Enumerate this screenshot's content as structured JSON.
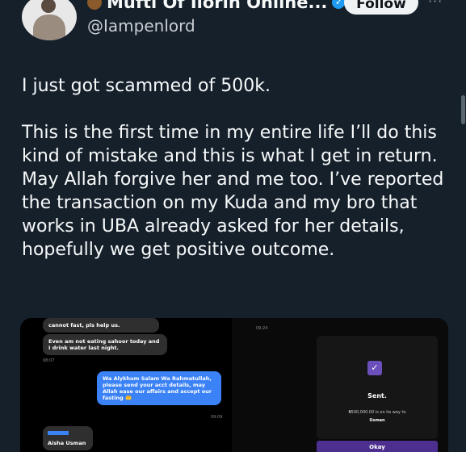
{
  "header": {
    "display_name": "Mufti Of Ilorin Online...",
    "handle": "@Iampenlord",
    "follow_label": "Follow",
    "more_label": "···"
  },
  "tweet": {
    "paragraphs": [
      "I just got scammed of 500k.",
      "This is the first time in my entire life I’ll do this kind of mistake and this is what I get in return. May Allah forgive her and me too. I’ve reported the transaction on my Kuda and my bro that works in UBA already asked for her details, hopefully we get positive outcome."
    ]
  },
  "media": {
    "chat": {
      "msg1": "cannot fast, pls help us.",
      "msg2": "Even am not eating sahoor today and I drink water last night.",
      "msg2_time": "08:07",
      "msg3": "Wa Alykhum Salam Wa Rahmatullah, please send your acct details, may Allah ease our affairs and accept our fasting 🤲",
      "msg3_time": "09:09",
      "contact_name": "Aisha Usman"
    },
    "receipt": {
      "time": "09:24",
      "status": "Sent.",
      "amount_text": "₦500,000.00 is on its way to",
      "recipient": "Usman",
      "okay_label": "Okay"
    }
  },
  "colors": {
    "background": "#15202b",
    "text": "#f7f9f9",
    "handle": "#c9cdd1",
    "verified": "#1d9bf0",
    "chat_outgoing": "#3b82f6",
    "kuda_purple": "#4c2f8f"
  }
}
